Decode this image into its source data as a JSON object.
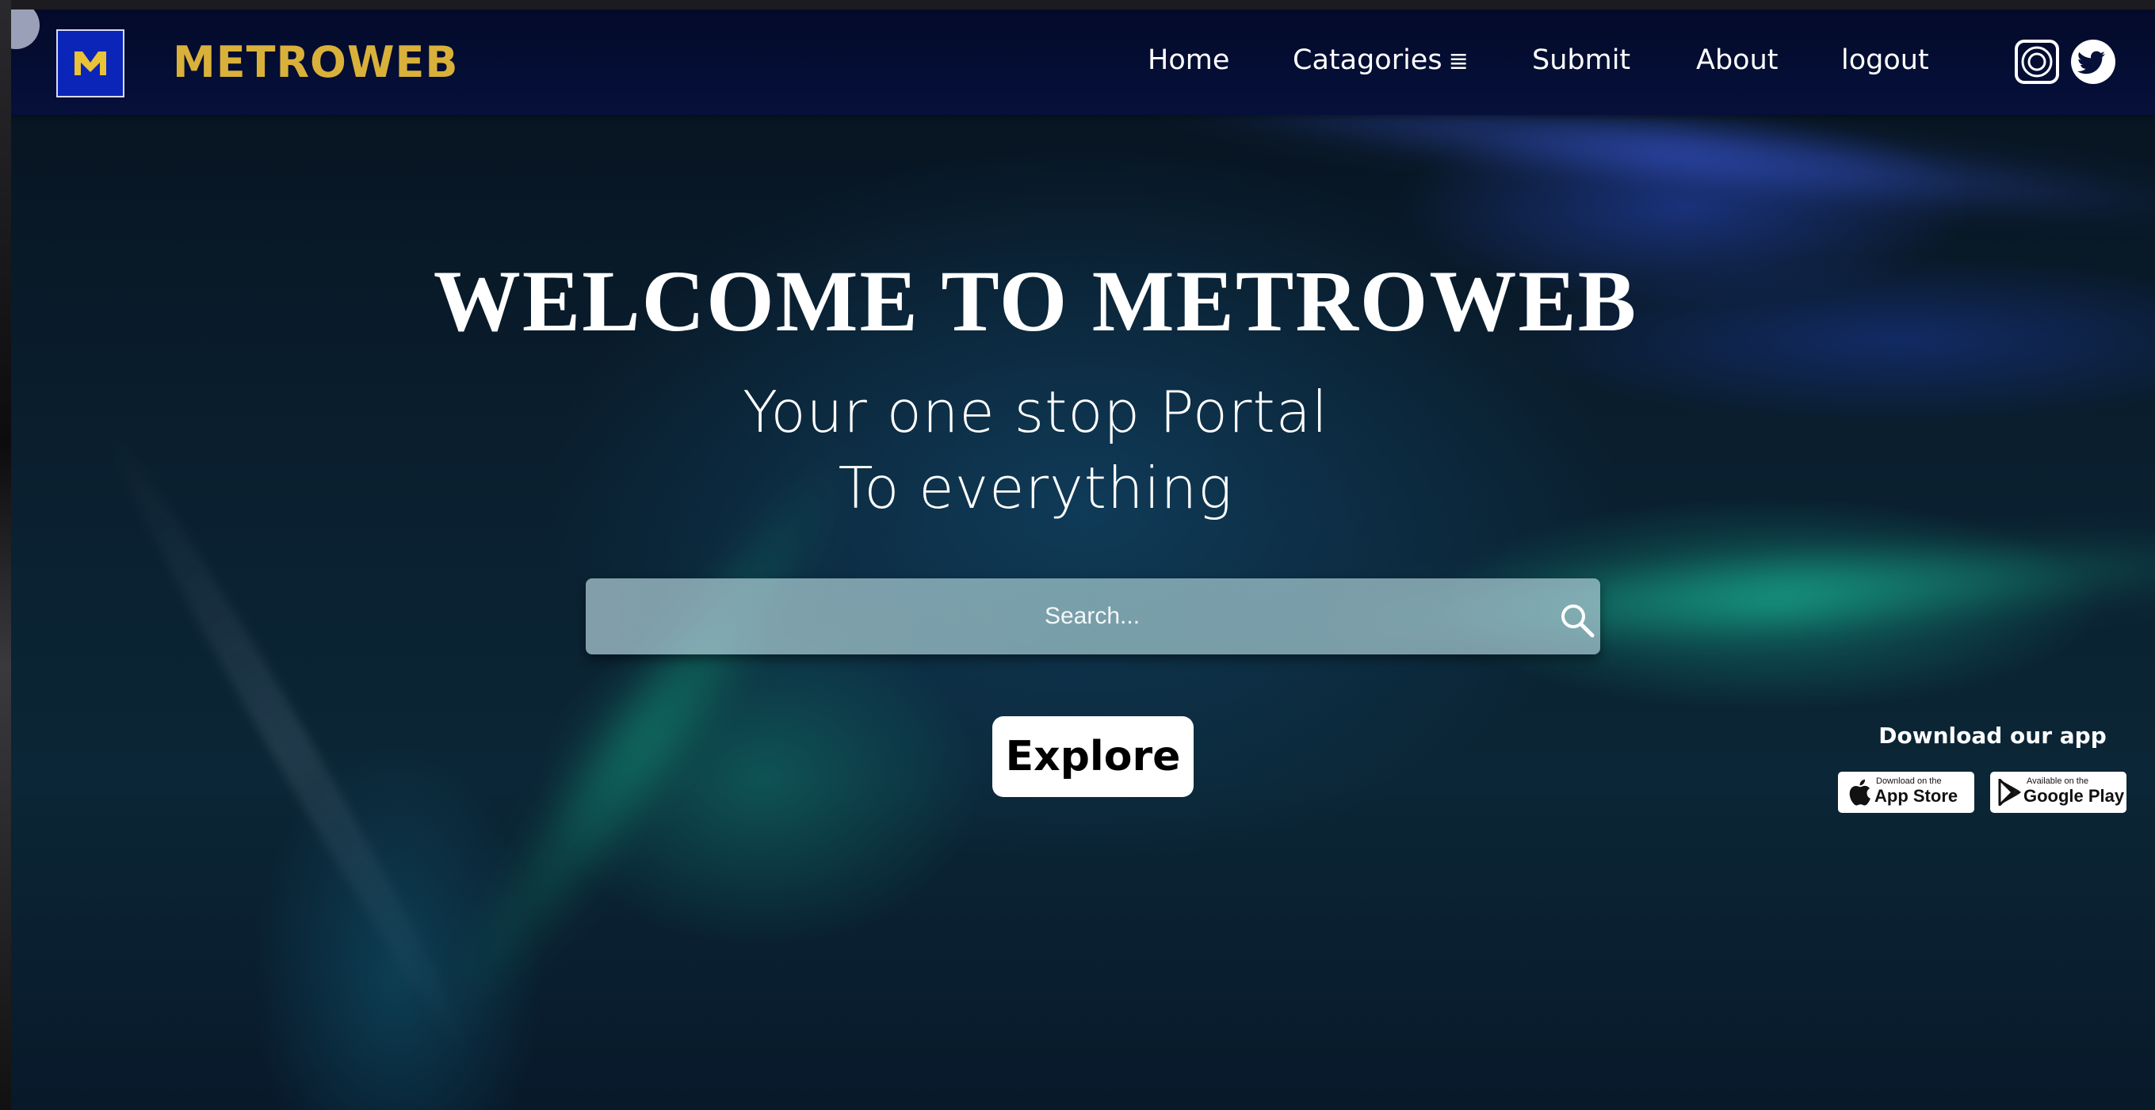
{
  "header": {
    "brand": "METROWEB",
    "logo_icon": "metroweb-m-logo-icon",
    "nav": [
      {
        "label": "Home"
      },
      {
        "label": "Catagories",
        "icon": "menu-lines-icon",
        "glyph": "≣"
      },
      {
        "label": "Submit"
      },
      {
        "label": "About"
      },
      {
        "label": "logout"
      }
    ],
    "social": [
      {
        "icon": "instagram-icon"
      },
      {
        "icon": "twitter-icon"
      }
    ]
  },
  "hero": {
    "title": "WELCOME TO METROWEB",
    "subtitle_line1": "Your one stop Portal",
    "subtitle_line2": "To everything"
  },
  "search": {
    "placeholder": "Search...",
    "value": "",
    "icon": "search-icon"
  },
  "explore": {
    "label": "Explore"
  },
  "download": {
    "label": "Download our app",
    "app_store": {
      "small": "Download on the",
      "big": "App Store",
      "icon": "apple-icon"
    },
    "google_play": {
      "small": "Available on the",
      "big": "Google Play",
      "icon": "google-play-icon"
    }
  },
  "colors": {
    "brand_gold": "#d9b13a",
    "logo_blue": "#0b25b8",
    "navbar": "#06103a"
  }
}
